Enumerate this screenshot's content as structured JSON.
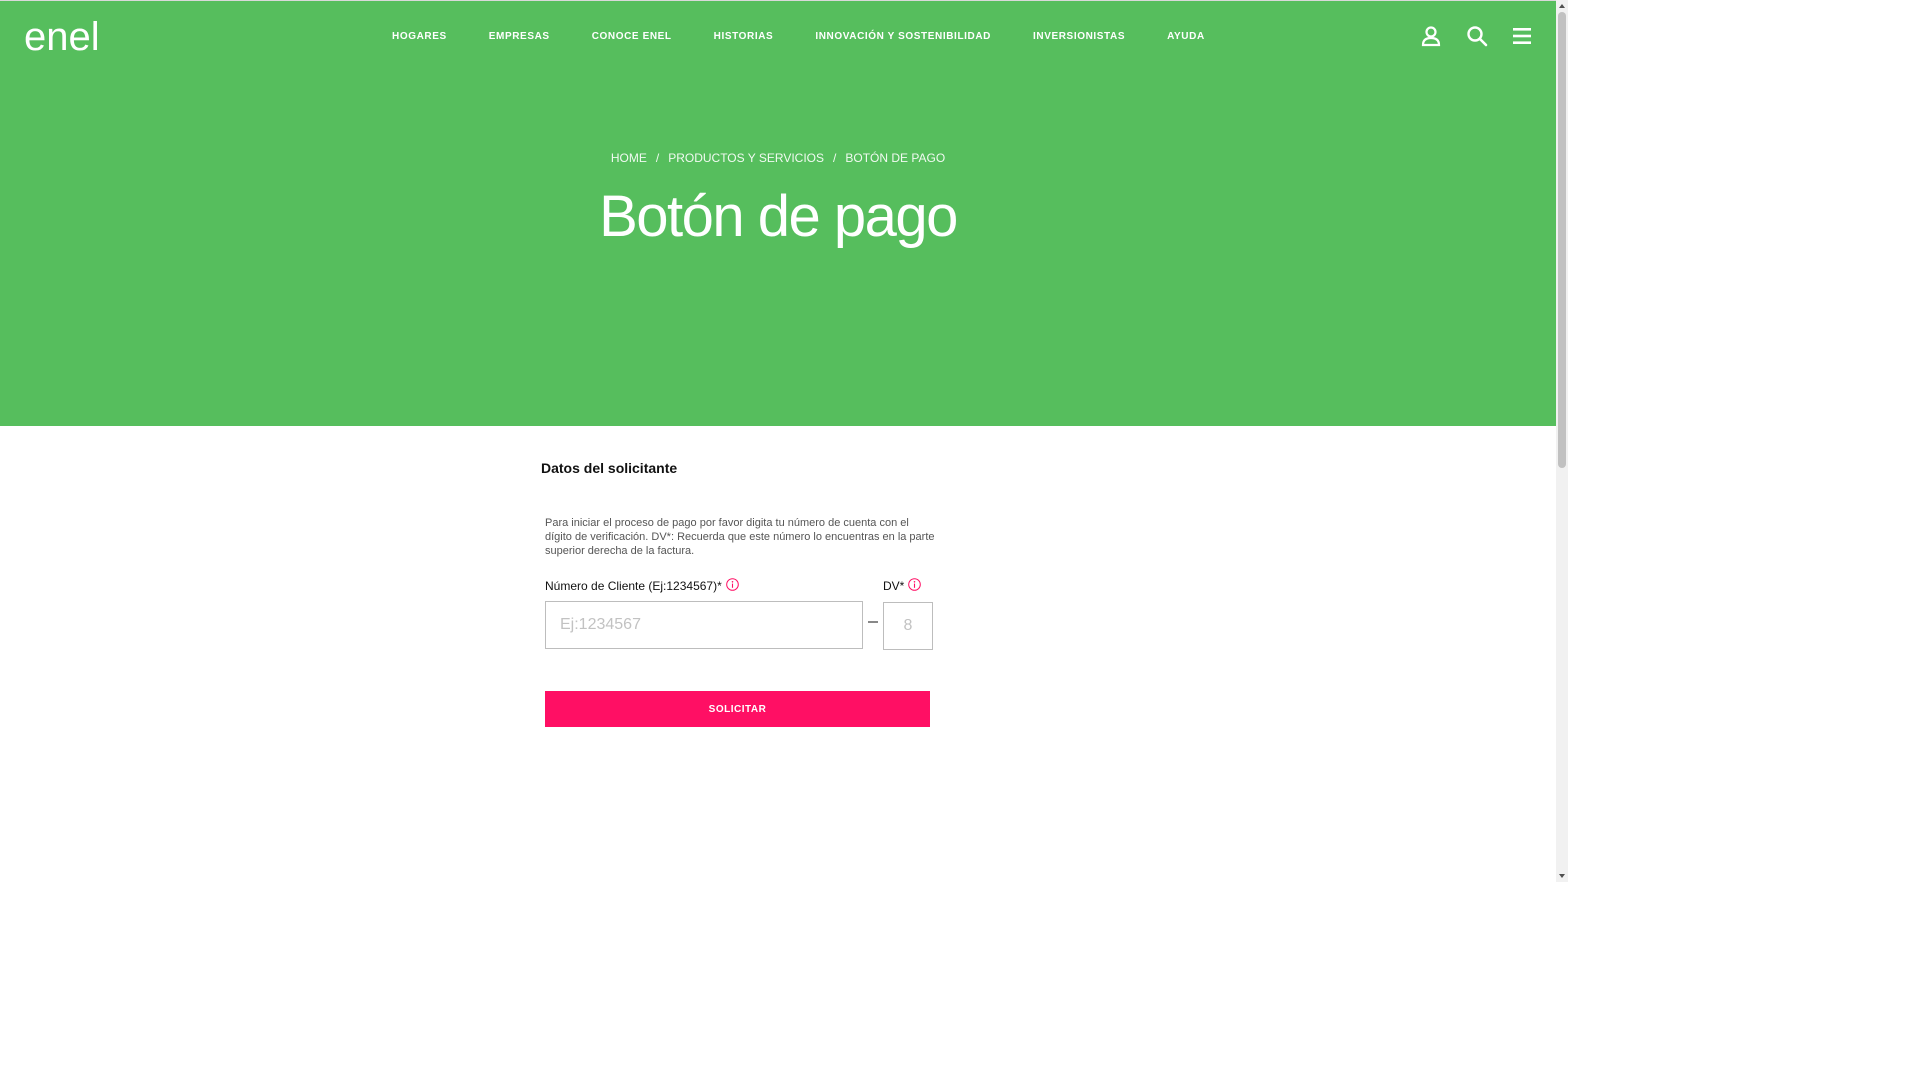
{
  "header": {
    "logo_text": "enel",
    "nav": [
      "HOGARES",
      "EMPRESAS",
      "CONOCE ENEL",
      "HISTORIAS",
      "INNOVACIÓN Y SOSTENIBILIDAD",
      "INVERSIONISTAS",
      "AYUDA"
    ],
    "icons": [
      "user-icon",
      "search-icon",
      "menu-icon"
    ]
  },
  "hero": {
    "breadcrumb": [
      "HOME",
      "PRODUCTOS Y SERVICIOS",
      "BOTÓN DE PAGO"
    ],
    "breadcrumb_separator": "/",
    "title": "Botón de pago"
  },
  "form": {
    "section_title": "Datos del solicitante",
    "help_text": "Para iniciar el proceso de pago por favor digita tu número de cuenta con el dígito de verificación. DV*: Recuerda que este número lo encuentras en la parte superior derecha de la factura.",
    "client_label": "Número de Cliente (Ej:1234567)*",
    "client_placeholder": "Ej:1234567",
    "client_value": "",
    "dv_label": "DV*",
    "dv_placeholder": "8",
    "dv_value": "",
    "submit_label": "SOLICITAR"
  },
  "colors": {
    "hero_green": "#56be5d",
    "accent_pink": "#ff0f64",
    "info_icon": "#ff0f64"
  }
}
